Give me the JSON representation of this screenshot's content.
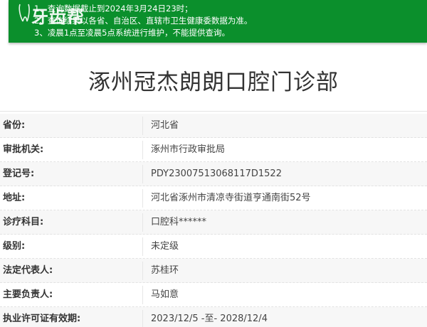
{
  "notice": {
    "lines": [
      "1、查询数据截止到2024年3月24日23时；",
      "2、查询结果以各省、自治区、直辖市卫生健康委数据为准。",
      "3、凌晨1点至凌晨5点系统进行维护，不能提供查询。"
    ],
    "background_color": "#0b8f2c"
  },
  "watermark": {
    "text": "牙齿帮"
  },
  "title": "涿州冠杰朗朗口腔门诊部",
  "details": [
    {
      "label": "省份:",
      "value": "河北省"
    },
    {
      "label": "审批机关:",
      "value": "涿州市行政审批局"
    },
    {
      "label": "登记号:",
      "value": "PDY23007513068117D1522"
    },
    {
      "label": "地址:",
      "value": "河北省涿州市清凉寺街道亨通南街52号"
    },
    {
      "label": "诊疗科目:",
      "value": "口腔科******"
    },
    {
      "label": "级别:",
      "value": "未定级"
    },
    {
      "label": "法定代表人:",
      "value": "苏桂环"
    },
    {
      "label": "主要负责人:",
      "value": "马如意"
    },
    {
      "label": "执业许可证有效期:",
      "value": "2023/12/5 -至- 2028/12/4"
    }
  ]
}
